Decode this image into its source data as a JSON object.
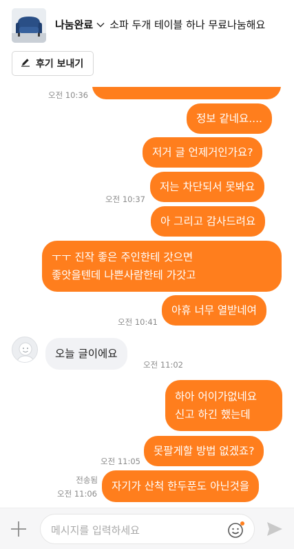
{
  "header": {
    "status": "나눔완료",
    "item_title": "소파 두개 테이블 하나 무료나눔해요",
    "review_button": "후기 보내기"
  },
  "messages": [
    {
      "side": "out",
      "text": "",
      "time": "오전 10:36"
    },
    {
      "side": "out",
      "text": "정보 같네요....",
      "time": ""
    },
    {
      "side": "out",
      "text": "저거 글 언제거인가요?",
      "time": ""
    },
    {
      "side": "out",
      "text": "저는 차단되서 못봐요",
      "time": "오전 10:37"
    },
    {
      "side": "out",
      "text": "아 그리고 감사드려요",
      "time": ""
    },
    {
      "side": "out",
      "lines": [
        "ㅜㅜ 진작 좋은 주인한테 갓으면",
        "좋앗을텐데 나쁜사람한테 가갓고"
      ],
      "time": ""
    },
    {
      "side": "out",
      "text": "아휴 너무 열받네여",
      "time": "오전 10:41"
    },
    {
      "side": "in",
      "text": "오늘 글이에요",
      "time": "오전 11:02"
    },
    {
      "side": "out",
      "lines": [
        "하아 어이가없네요",
        "신고 하긴 했는데"
      ],
      "time": ""
    },
    {
      "side": "out",
      "text": "못팔게할 방법 없겠죠?",
      "time": "오전 11:05"
    },
    {
      "side": "out",
      "text": "자기가 산척 한두푼도 아닌것을",
      "time": "오전 11:06",
      "sent_label": "전송됨"
    }
  ],
  "composer": {
    "placeholder": "메시지를 입력하세요"
  },
  "icons": {
    "item_thumbnail": "sofa-photo",
    "dropdown": "chevron-down-icon",
    "review": "pencil-icon",
    "attach": "plus-icon",
    "emoji": "emoji-icon",
    "send": "send-icon",
    "avatar": "default-avatar-icon"
  },
  "colors": {
    "outgoing_bubble": "#ff7e1d",
    "incoming_bubble": "#f1f2f5",
    "accent_dot": "#ff7e1d"
  }
}
